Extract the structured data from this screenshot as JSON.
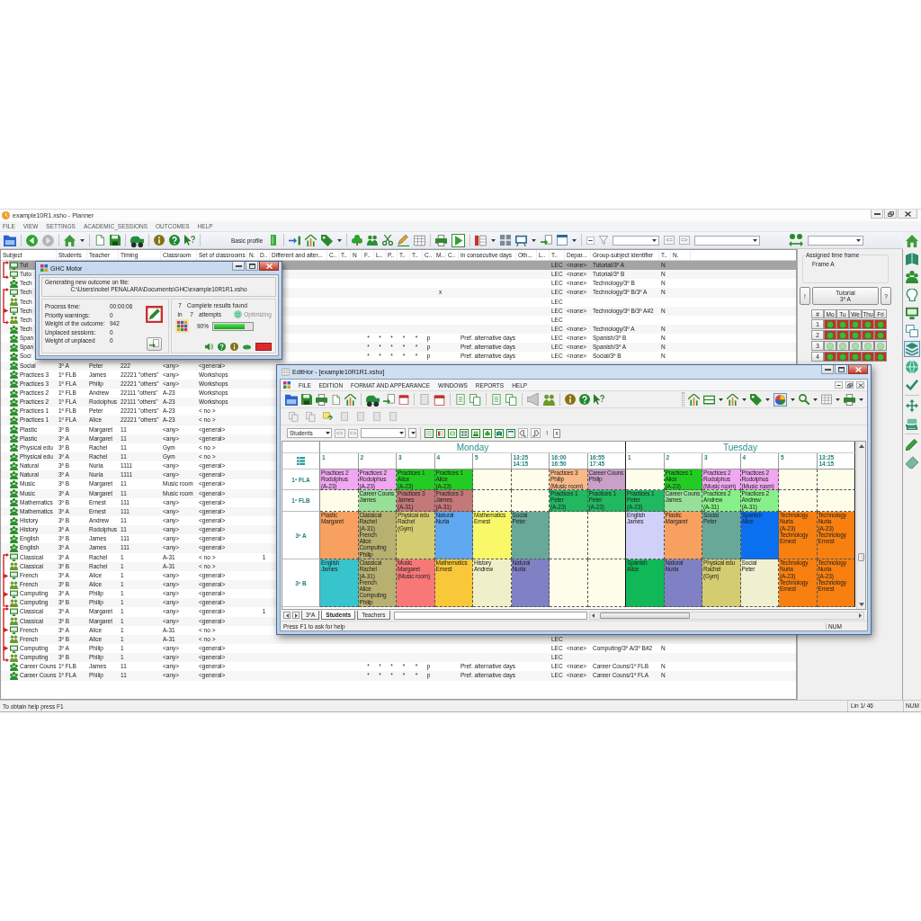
{
  "main_window": {
    "title": "example10R1.xsho - Planner",
    "menu": [
      "FILE",
      "VIEW",
      "SETTINGS",
      "ACADEMIC_SESSIONS",
      "OUTCOMES",
      "HELP"
    ],
    "toolbar": {
      "profile_label": "Basic profile",
      "nav_buttons": [
        "<=",
        "=>"
      ]
    },
    "table": {
      "columns": [
        "Subject",
        "Students",
        "Teacher",
        "Timing",
        "Classroom",
        "Set of classrooms",
        "N.",
        "D..",
        "Different and alter...",
        "C..",
        "T..",
        "N",
        "F..",
        "L..",
        "P..",
        "T..",
        "T..",
        "C..",
        "M..",
        "C..",
        "In consecutive days",
        "Oth...",
        "L..",
        "T..",
        "Depar...",
        "Group-subject identifier",
        "T..",
        "N."
      ],
      "rows": [
        {
          "kind": "group",
          "rows": [
            {
              "kind": "lead",
              "selected": true,
              "subject": "Tut",
              "t_4": "LEC",
              "department": "<none>",
              "group_subject_identifier": "Tutorial/3º A",
              "t_5": "N"
            },
            {
              "kind": "lead",
              "selected": false,
              "subject": "Tuto",
              "t_4": "LEC",
              "department": "<none>",
              "group_subject_identifier": "Tutorial/3º B",
              "t_5": "N"
            }
          ]
        },
        {
          "kind": "single",
          "selected": false,
          "subject": "Tech",
          "t_4": "LEC",
          "department": "<none>",
          "group_subject_identifier": "Technology/3º B",
          "t_5": "N"
        },
        {
          "kind": "group",
          "rows": [
            {
              "kind": "lead",
              "selected": false,
              "subject": "Tech",
              "m": "x",
              "t_4": "LEC",
              "department": "<none>",
              "group_subject_identifier": "Technology/3º B/3º A",
              "t_5": "N"
            },
            {
              "kind": "member",
              "selected": false,
              "subject": "Tech",
              "t_4": "LEC"
            },
            {
              "kind": "lead",
              "selected": false,
              "subject": "Tech",
              "t_4": "LEC",
              "department": "<none>",
              "group_subject_identifier": "Technology/3º B/3º A#2",
              "t_5": "N"
            },
            {
              "kind": "member",
              "selected": false,
              "subject": "Tech",
              "t_4": "LEC"
            }
          ]
        },
        {
          "kind": "single",
          "selected": false,
          "subject": "Tech",
          "t_4": "LEC",
          "department": "<none>",
          "group_subject_identifier": "Technology/3º A",
          "t_5": "N"
        },
        {
          "kind": "single",
          "selected": false,
          "subject": "Span",
          "f": "*",
          "l": "*",
          "p": "*",
          "t_2": "*",
          "t_3": "*",
          "c_2": "p",
          "in_consecutive_days": "Pref. alternative days",
          "t_4": "LEC",
          "department": "<none>",
          "group_subject_identifier": "Spanish/3º B",
          "t_5": "N"
        },
        {
          "kind": "single",
          "selected": false,
          "subject": "Span",
          "f": "*",
          "l": "*",
          "p": "*",
          "t_2": "*",
          "t_3": "*",
          "c_2": "p",
          "in_consecutive_days": "Pref. alternative days",
          "t_4": "LEC",
          "department": "<none>",
          "group_subject_identifier": "Spanish/3º A",
          "t_5": "N"
        },
        {
          "kind": "single",
          "selected": false,
          "subject": "Soci",
          "f": "*",
          "l": "*",
          "p": "*",
          "t_2": "*",
          "t_3": "*",
          "c_2": "p",
          "in_consecutive_days": "Pref. alternative days",
          "t_4": "LEC",
          "department": "<none>",
          "group_subject_identifier": "Social/3º B",
          "t_5": "N"
        },
        {
          "kind": "single",
          "selected": false,
          "subject": "Social",
          "students": "3º A",
          "teacher": "Peter",
          "timing": "222",
          "classroom": "<any>",
          "set_of_classrooms": "<general>"
        },
        {
          "kind": "single",
          "selected": false,
          "subject": "Practices 3",
          "students": "1º FLB",
          "teacher": "James",
          "timing": "22221 \"others\"",
          "classroom": "<any>",
          "set_of_classrooms": "Workshops"
        },
        {
          "kind": "single",
          "selected": false,
          "subject": "Practices 3",
          "students": "1º FLA",
          "teacher": "Philip",
          "timing": "22221 \"others\"",
          "classroom": "<any>",
          "set_of_classrooms": "Workshops"
        },
        {
          "kind": "single",
          "selected": false,
          "subject": "Practices 2",
          "students": "1º FLB",
          "teacher": "Andrew",
          "timing": "22111 \"others\"",
          "classroom": "A-23",
          "set_of_classrooms": "Workshops"
        },
        {
          "kind": "single",
          "selected": false,
          "subject": "Practices 2",
          "students": "1º FLA",
          "teacher": "Rodolphus",
          "timing": "22111 \"others\"",
          "classroom": "A-23",
          "set_of_classrooms": "Workshops"
        },
        {
          "kind": "single",
          "selected": false,
          "subject": "Practices 1",
          "students": "1º FLB",
          "teacher": "Peter",
          "timing": "22221 \"others\"",
          "classroom": "A-23",
          "set_of_classrooms": "< no >"
        },
        {
          "kind": "single",
          "selected": false,
          "subject": "Practices 1",
          "students": "1º FLA",
          "teacher": "Alice",
          "timing": "22221 \"others\"",
          "classroom": "A-23",
          "set_of_classrooms": "< no >"
        },
        {
          "kind": "single",
          "selected": false,
          "subject": "Plastic",
          "students": "3º B",
          "teacher": "Margaret",
          "timing": "11",
          "classroom": "<any>",
          "set_of_classrooms": "<general>"
        },
        {
          "kind": "single",
          "selected": false,
          "subject": "Plastic",
          "students": "3º A",
          "teacher": "Margaret",
          "timing": "11",
          "classroom": "<any>",
          "set_of_classrooms": "<general>"
        },
        {
          "kind": "single",
          "selected": false,
          "subject": "Physical edu",
          "students": "3º B",
          "teacher": "Rachel",
          "timing": "11",
          "classroom": "Gym",
          "set_of_classrooms": "< no >"
        },
        {
          "kind": "single",
          "selected": false,
          "subject": "Physical edu",
          "students": "3º A",
          "teacher": "Rachel",
          "timing": "11",
          "classroom": "Gym",
          "set_of_classrooms": "< no >"
        },
        {
          "kind": "single",
          "selected": false,
          "subject": "Natural",
          "students": "3º B",
          "teacher": "Nuria",
          "timing": "1111",
          "classroom": "<any>",
          "set_of_classrooms": "<general>"
        },
        {
          "kind": "single",
          "selected": false,
          "subject": "Natural",
          "students": "3º A",
          "teacher": "Nuria",
          "timing": "1111",
          "classroom": "<any>",
          "set_of_classrooms": "<general>"
        },
        {
          "kind": "single",
          "selected": false,
          "subject": "Music",
          "students": "3º B",
          "teacher": "Margaret",
          "timing": "11",
          "classroom": "Music room",
          "set_of_classrooms": "<general>"
        },
        {
          "kind": "single",
          "selected": false,
          "subject": "Music",
          "students": "3º A",
          "teacher": "Margaret",
          "timing": "11",
          "classroom": "Music room",
          "set_of_classrooms": "<general>"
        },
        {
          "kind": "single",
          "selected": false,
          "subject": "Mathematics",
          "students": "3º B",
          "teacher": "Ernest",
          "timing": "111",
          "classroom": "<any>",
          "set_of_classrooms": "<general>"
        },
        {
          "kind": "single",
          "selected": false,
          "subject": "Mathematics",
          "students": "3º A",
          "teacher": "Ernest",
          "timing": "111",
          "classroom": "<any>",
          "set_of_classrooms": "<general>"
        },
        {
          "kind": "single",
          "selected": false,
          "subject": "History",
          "students": "3º B",
          "teacher": "Andrew",
          "timing": "11",
          "classroom": "<any>",
          "set_of_classrooms": "<general>"
        },
        {
          "kind": "single",
          "selected": false,
          "subject": "History",
          "students": "3º A",
          "teacher": "Rodolphus",
          "timing": "11",
          "classroom": "<any>",
          "set_of_classrooms": "<general>"
        },
        {
          "kind": "single",
          "selected": false,
          "subject": "English",
          "students": "3º B",
          "teacher": "James",
          "timing": "111",
          "classroom": "<any>",
          "set_of_classrooms": "<general>"
        },
        {
          "kind": "single",
          "selected": false,
          "subject": "English",
          "students": "3º A",
          "teacher": "James",
          "timing": "111",
          "classroom": "<any>",
          "set_of_classrooms": "<general>"
        },
        {
          "kind": "group",
          "rows": [
            {
              "kind": "lead",
              "selected": false,
              "subject": "Classical",
              "students": "3º A",
              "teacher": "Rachel",
              "timing": "1",
              "classroom": "A-31",
              "set_of_classrooms": "< no >",
              "d": "1"
            },
            {
              "kind": "member",
              "selected": false,
              "subject": "Classical",
              "students": "3º B",
              "teacher": "Rachel",
              "timing": "1",
              "classroom": "A-31",
              "set_of_classrooms": "< no >"
            },
            {
              "kind": "lead",
              "selected": false,
              "subject": "French",
              "students": "3º A",
              "teacher": "Alice",
              "timing": "1",
              "classroom": "<any>",
              "set_of_classrooms": "<general>"
            },
            {
              "kind": "member",
              "selected": false,
              "subject": "French",
              "students": "3º B",
              "teacher": "Alice",
              "timing": "1",
              "classroom": "<any>",
              "set_of_classrooms": "<general>"
            },
            {
              "kind": "lead",
              "selected": false,
              "subject": "Computing",
              "students": "3º A",
              "teacher": "Philip",
              "timing": "1",
              "classroom": "<any>",
              "set_of_classrooms": "<general>"
            },
            {
              "kind": "member",
              "selected": false,
              "subject": "Computing",
              "students": "3º B",
              "teacher": "Philip",
              "timing": "1",
              "classroom": "<any>",
              "set_of_classrooms": "<general>"
            }
          ]
        },
        {
          "kind": "group",
          "rows": [
            {
              "kind": "lead",
              "selected": false,
              "subject": "Classical",
              "students": "3º A",
              "teacher": "Margaret",
              "timing": "1",
              "classroom": "<any>",
              "set_of_classrooms": "<general>",
              "d": "1"
            },
            {
              "kind": "member",
              "selected": false,
              "subject": "Classical",
              "students": "3º B",
              "teacher": "Margaret",
              "timing": "1",
              "classroom": "<any>",
              "set_of_classrooms": "<general>"
            },
            {
              "kind": "lead",
              "selected": false,
              "subject": "French",
              "students": "3º A",
              "teacher": "Alice",
              "timing": "1",
              "classroom": "A-31",
              "set_of_classrooms": "< no >"
            },
            {
              "kind": "member",
              "selected": false,
              "subject": "French",
              "students": "3º B",
              "teacher": "Alice",
              "timing": "1",
              "classroom": "A-31",
              "set_of_classrooms": "< no >",
              "t_4": "LEC"
            },
            {
              "kind": "lead",
              "selected": false,
              "subject": "Computing",
              "students": "3º A",
              "teacher": "Philip",
              "timing": "1",
              "classroom": "<any>",
              "set_of_classrooms": "<general>",
              "t_4": "LEC",
              "department": "<none>",
              "group_subject_identifier": "Computing/3º A/3º B#2",
              "t_5": "N"
            },
            {
              "kind": "member",
              "selected": false,
              "subject": "Computing",
              "students": "3º B",
              "teacher": "Philip",
              "timing": "1",
              "classroom": "<any>",
              "set_of_classrooms": "<general>",
              "t_4": "LEC"
            }
          ]
        },
        {
          "kind": "single",
          "selected": false,
          "subject": "Career Couns",
          "students": "1º FLB",
          "teacher": "James",
          "timing": "11",
          "classroom": "<any>",
          "set_of_classrooms": "<general>",
          "f": "*",
          "l": "*",
          "p": "*",
          "t_2": "*",
          "t_3": "*",
          "c_2": "p",
          "in_consecutive_days": "Pref. alternative days",
          "t_4": "LEC",
          "department": "<none>",
          "group_subject_identifier": "Career Couns/1º FLB",
          "t_5": "N"
        },
        {
          "kind": "single",
          "selected": false,
          "subject": "Career Couns",
          "students": "1º FLA",
          "teacher": "Philip",
          "timing": "11",
          "classroom": "<any>",
          "set_of_classrooms": "<general>",
          "f": "*",
          "l": "*",
          "p": "*",
          "t_2": "*",
          "t_3": "*",
          "c_2": "p",
          "in_consecutive_days": "Pref. alternative days",
          "t_4": "LEC",
          "department": "<none>",
          "group_subject_identifier": "Career Couns/1º FLA",
          "t_5": "N"
        }
      ]
    },
    "time_frame": {
      "title": "Assigned time frame",
      "name": "Frame A",
      "session": {
        "left_button": "!",
        "label": "Tutorial",
        "group": "3º A",
        "right_button": "?"
      },
      "corner": "#",
      "days": [
        "Mo",
        "Tu",
        "We",
        "Thu",
        "Fri"
      ],
      "rows": [
        {
          "label": "1",
          "slots": [
            {
              "highlighted": true
            },
            {
              "highlighted": true
            },
            {
              "highlighted": true
            },
            {
              "highlighted": true
            },
            {
              "highlighted": true
            }
          ]
        },
        {
          "label": "2",
          "slots": [
            {
              "highlighted": true
            },
            {
              "highlighted": true
            },
            {
              "highlighted": true
            },
            {
              "highlighted": true
            },
            {
              "highlighted": true
            }
          ]
        },
        {
          "label": "3",
          "slots": [
            {
              "highlighted": false
            },
            {
              "highlighted": false
            },
            {
              "highlighted": false
            },
            {
              "highlighted": false
            },
            {
              "highlighted": false
            }
          ]
        },
        {
          "label": "4",
          "slots": [
            {
              "highlighted": true
            },
            {
              "highlighted": true
            },
            {
              "highlighted": true
            },
            {
              "highlighted": true
            },
            {
              "highlighted": true
            }
          ]
        }
      ]
    },
    "side_toolbar": [
      {
        "selected": false
      },
      {
        "selected": false
      },
      {
        "selected": false
      },
      {
        "selected": false
      },
      {
        "selected": false
      },
      {
        "selected": false
      },
      {
        "selected": true
      },
      {
        "selected": false
      },
      {
        "selected": false
      },
      {
        "selected": false
      },
      {
        "selected": false
      },
      {
        "selected": false
      },
      {
        "selected": false
      }
    ],
    "status_bar": [
      "To obtain help press F1",
      "Lin 1/ 46",
      "NUM"
    ]
  },
  "motor_dialog": {
    "title": "GHC Motor",
    "heading": "Generating new outcome on file:",
    "path": "C:\\Users\\nobel PENALARA\\Documents\\GHC\\example10R1R1.xsho",
    "stats": [
      {
        "label": "Process time:",
        "value": "00:00:06"
      },
      {
        "label": "Priority warnings:",
        "value": "0"
      },
      {
        "label": "Weight of the outcome:",
        "value": "942"
      },
      {
        "label": "Unplaced sessions:",
        "value": "0"
      },
      {
        "label": "Weight of unplaced",
        "value": "0"
      }
    ],
    "results": {
      "count": "7",
      "label": "Complete results found",
      "prefix": "in",
      "attempts": "7",
      "suffix": "attempts"
    },
    "status": "Optimizing",
    "progress": {
      "reading": "90%",
      "level": 0.8
    }
  },
  "edithor": {
    "title": "EditHor - [example10R1R1.xsho]",
    "menu": [
      "FILE",
      "EDITION",
      "FORMAT AND APPEARANCE",
      "WINDOWS",
      "REPORTS",
      "HELP"
    ],
    "view": "Students",
    "nav_buttons": [
      "<=",
      "=>"
    ],
    "tool_buttons": [
      {
        "kind": "alert",
        "label": "!"
      },
      {
        "kind": "clear",
        "label": "x"
      }
    ],
    "days": [
      {
        "name": "Monday",
        "periods": [
          {
            "lines": [
              "1"
            ]
          },
          {
            "lines": [
              "2"
            ]
          },
          {
            "lines": [
              "3"
            ]
          },
          {
            "lines": [
              "4"
            ]
          },
          {
            "lines": [
              "5"
            ]
          },
          {
            "lines": [
              "13:25",
              "14:15"
            ]
          },
          {
            "lines": [
              "16:00",
              "16:50"
            ]
          },
          {
            "lines": [
              "16:55",
              "17:45"
            ]
          }
        ]
      },
      {
        "name": "Tuesday",
        "periods": [
          {
            "lines": [
              "1"
            ]
          },
          {
            "lines": [
              "2"
            ]
          },
          {
            "lines": [
              "3"
            ]
          },
          {
            "lines": [
              "4"
            ]
          },
          {
            "lines": [
              "5"
            ]
          },
          {
            "lines": [
              "13:25",
              "14:15"
            ]
          }
        ]
      }
    ],
    "rows": [
      {
        "label": "1º FLA",
        "cells": [
          {
            "kind": "session",
            "lines": [
              "Practices 2",
              "Rodolphus",
              "(A-23)"
            ],
            "color": "#f0a8f0"
          },
          {
            "kind": "session",
            "lines": [
              "Practices 2",
              "Rodolphus",
              "(A-23)"
            ],
            "color": "#f0a8f0"
          },
          {
            "kind": "session",
            "lines": [
              "Practices 1",
              "Alice",
              "(A-23)"
            ],
            "color": "#22cc22"
          },
          {
            "kind": "session",
            "lines": [
              "Practices 1",
              "Alice",
              "(A-23)"
            ],
            "color": "#22cc22"
          },
          {
            "kind": "free"
          },
          {
            "kind": "free"
          },
          {
            "kind": "session",
            "lines": [
              "Practices 3",
              "Philip",
              "(Music room)"
            ],
            "color": "#f8b888"
          },
          {
            "kind": "session",
            "lines": [
              "Career Couns",
              "Philip"
            ],
            "color": "#c8a0c8"
          },
          {
            "kind": "free"
          },
          {
            "kind": "session",
            "lines": [
              "Practices 1",
              "Alice",
              "(A-23)"
            ],
            "color": "#22cc22"
          },
          {
            "kind": "session",
            "lines": [
              "Practices 2",
              "Rodolphus",
              "(Music room)"
            ],
            "color": "#f0a8f0"
          },
          {
            "kind": "session",
            "lines": [
              "Practices 2",
              "Rodolphus",
              "(Music room)"
            ],
            "color": "#f0a8f0"
          },
          {
            "kind": "free"
          },
          {
            "kind": "free"
          }
        ]
      },
      {
        "label": "1º FLB",
        "cells": [
          {
            "kind": "free"
          },
          {
            "kind": "session",
            "lines": [
              "Career Couns",
              "James"
            ],
            "color": "#98e098"
          },
          {
            "kind": "session",
            "lines": [
              "Practices 3",
              "James",
              "(A-31)"
            ],
            "color": "#c47878"
          },
          {
            "kind": "session",
            "lines": [
              "Practices 3",
              "James",
              "(A-31)"
            ],
            "color": "#c47878"
          },
          {
            "kind": "free"
          },
          {
            "kind": "free"
          },
          {
            "kind": "session",
            "lines": [
              "Practices 1",
              "Peter",
              "(A-23)"
            ],
            "color": "#20b860"
          },
          {
            "kind": "session",
            "lines": [
              "Practices 1",
              "Peter",
              "(A-23)"
            ],
            "color": "#20b860"
          },
          {
            "kind": "session",
            "lines": [
              "Practices 1",
              "Peter",
              "(A-23)"
            ],
            "color": "#20b860"
          },
          {
            "kind": "session",
            "lines": [
              "Career Couns",
              "James"
            ],
            "color": "#98e098"
          },
          {
            "kind": "session",
            "lines": [
              "Practices 2",
              "Andrew",
              "(A-31)"
            ],
            "color": "#88f088"
          },
          {
            "kind": "session",
            "lines": [
              "Practices 2",
              "Andrew",
              "(A-31)"
            ],
            "color": "#88f088"
          },
          {
            "kind": "free"
          },
          {
            "kind": "free"
          }
        ]
      },
      {
        "label": "3º A",
        "cells": [
          {
            "kind": "session",
            "lines": [
              "Plastic",
              "Margaret"
            ],
            "color": "#f8a060"
          },
          {
            "kind": "session",
            "lines": [
              "Classical",
              "Rachel",
              "(A-31)",
              "French",
              "Alice",
              "Computing",
              "Philip"
            ],
            "color": "#b8b070"
          },
          {
            "kind": "session",
            "lines": [
              "Physical edu",
              "Rachel",
              "(Gym)"
            ],
            "color": "#d4cc70"
          },
          {
            "kind": "session",
            "lines": [
              "Natural",
              "Nuria"
            ],
            "color": "#60a8f0"
          },
          {
            "kind": "session",
            "lines": [
              "Mathematics",
              "Ernest"
            ],
            "color": "#f8f868"
          },
          {
            "kind": "session",
            "lines": [
              "Social",
              "Peter"
            ],
            "color": "#68a898"
          },
          {
            "kind": "free"
          },
          {
            "kind": "free"
          },
          {
            "kind": "session",
            "lines": [
              "English",
              "James"
            ],
            "color": "#d0d0f8"
          },
          {
            "kind": "session",
            "lines": [
              "Plastic",
              "Margaret"
            ],
            "color": "#f8a060"
          },
          {
            "kind": "session",
            "lines": [
              "Social",
              "Peter"
            ],
            "color": "#68a898"
          },
          {
            "kind": "session",
            "lines": [
              "Spanish",
              "Alice"
            ],
            "color": "#0a70f0"
          },
          {
            "kind": "session",
            "lines": [
              "Technology",
              "Nuria",
              "(A-23)",
              "Technology",
              "Ernest"
            ],
            "color": "#f88010"
          },
          {
            "kind": "session",
            "lines": [
              "Technology",
              "Nuria",
              "(A-23)",
              "Technology",
              "Ernest"
            ],
            "color": "#f88010"
          }
        ]
      },
      {
        "label": "3º B",
        "cells": [
          {
            "kind": "session",
            "lines": [
              "English",
              "James"
            ],
            "color": "#38c4cc"
          },
          {
            "kind": "session",
            "lines": [
              "Classical",
              "Rachel",
              "(A-31)",
              "French",
              "Alice",
              "Computing",
              "Philip"
            ],
            "color": "#b8b070"
          },
          {
            "kind": "session",
            "lines": [
              "Music",
              "Margaret",
              "(Music room)"
            ],
            "color": "#f87878"
          },
          {
            "kind": "session",
            "lines": [
              "Mathematics",
              "Ernest"
            ],
            "color": "#f8c838"
          },
          {
            "kind": "session",
            "lines": [
              "History",
              "Andrew"
            ],
            "color": "#f0f0c8"
          },
          {
            "kind": "session",
            "lines": [
              "Natural",
              "Nuria"
            ],
            "color": "#8080c4"
          },
          {
            "kind": "free"
          },
          {
            "kind": "free"
          },
          {
            "kind": "session",
            "lines": [
              "Spanish",
              "Alice"
            ],
            "color": "#10b858"
          },
          {
            "kind": "session",
            "lines": [
              "Natural",
              "Nuria"
            ],
            "color": "#8080c4"
          },
          {
            "kind": "session",
            "lines": [
              "Physical edu",
              "Rachel",
              "(Gym)"
            ],
            "color": "#d4cc70"
          },
          {
            "kind": "session",
            "lines": [
              "Social",
              "Peter"
            ],
            "color": "#f0f0d0"
          },
          {
            "kind": "session",
            "lines": [
              "Technology",
              "Nuria",
              "(A-23)",
              "Technology",
              "Ernest"
            ],
            "color": "#f88010"
          },
          {
            "kind": "session",
            "lines": [
              "Technology",
              "Nuria",
              "(A-23)",
              "Technology",
              "Ernest"
            ],
            "color": "#f88010"
          }
        ]
      }
    ],
    "tabs": [
      {
        "label": "3ºA",
        "selected": false
      },
      {
        "label": "Students",
        "selected": true
      },
      {
        "label": "Teachers",
        "selected": false
      }
    ],
    "status_bar": [
      "Press F1 to ask for help",
      "NUM"
    ]
  }
}
